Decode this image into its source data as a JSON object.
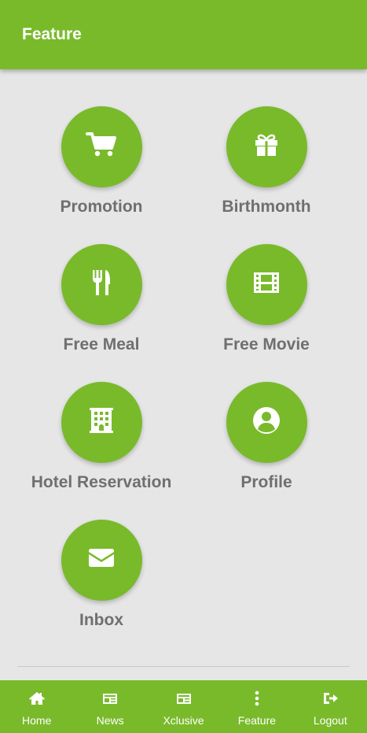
{
  "appbar": {
    "title": "Feature"
  },
  "features": [
    {
      "label": "Promotion",
      "icon": "cart-icon"
    },
    {
      "label": "Birthmonth",
      "icon": "gift-icon"
    },
    {
      "label": "Free Meal",
      "icon": "utensils-icon"
    },
    {
      "label": "Free Movie",
      "icon": "film-icon"
    },
    {
      "label": "Hotel Reservation",
      "icon": "building-icon"
    },
    {
      "label": "Profile",
      "icon": "user-circle-icon"
    },
    {
      "label": "Inbox",
      "icon": "envelope-icon"
    }
  ],
  "bottom_nav": [
    {
      "label": "Home",
      "icon": "home-icon"
    },
    {
      "label": "News",
      "icon": "newspaper-icon"
    },
    {
      "label": "Xclusive",
      "icon": "newspaper-icon"
    },
    {
      "label": "Feature",
      "icon": "dots-vertical-icon"
    },
    {
      "label": "Logout",
      "icon": "sign-out-icon"
    }
  ],
  "colors": {
    "primary": "#79ba2b",
    "background": "#e6e6e6",
    "label_text": "#6f6f6f"
  }
}
